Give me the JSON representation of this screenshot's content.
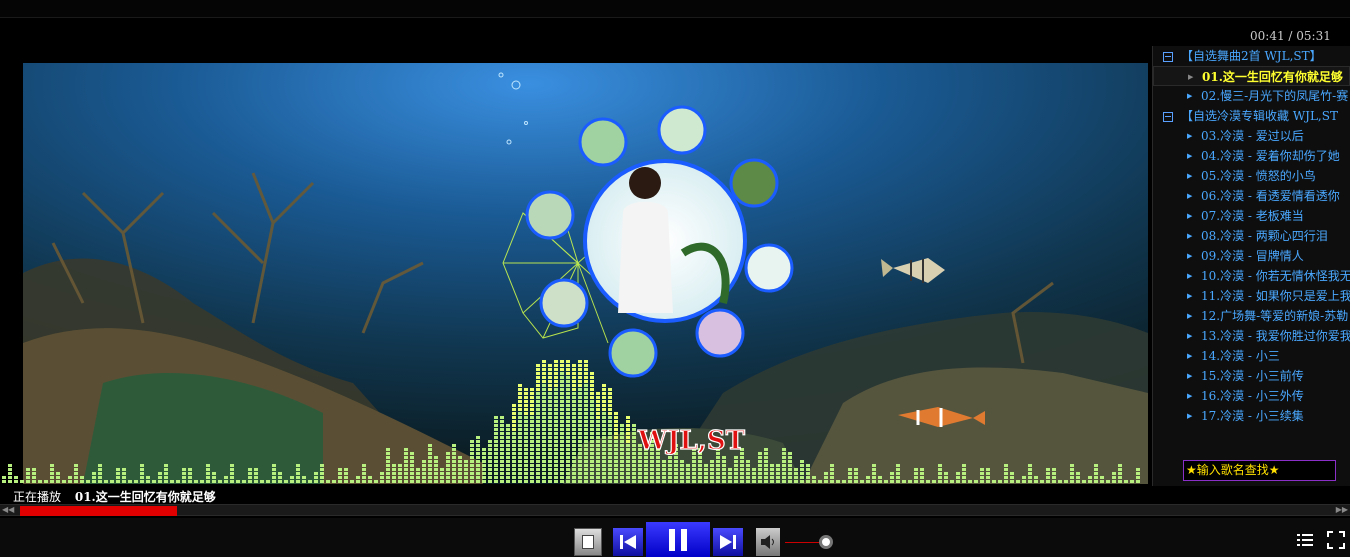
{
  "player": {
    "time_display": "00:41 / 05:31",
    "now_playing_label": "正在播放",
    "now_playing_title": "01.这一生回忆有你就足够",
    "progress_fraction": 0.12,
    "volume_fraction": 0.9,
    "watermark": "WJL,ST"
  },
  "playlist": {
    "rows": [
      {
        "kind": "group",
        "text": "【自选舞曲2首  WJL,ST】"
      },
      {
        "kind": "item",
        "text": "01.这一生回忆有你就足够",
        "active": true
      },
      {
        "kind": "item",
        "text": "02.慢三-月光下的凤尾竹-赛"
      },
      {
        "kind": "group",
        "text": "【自选冷漠专辑收藏  WJL,ST"
      },
      {
        "kind": "item",
        "text": "03.冷漠 - 爱过以后"
      },
      {
        "kind": "item",
        "text": "04.冷漠 - 爱着你却伤了她"
      },
      {
        "kind": "item",
        "text": "05.冷漠 - 愤怒的小鸟"
      },
      {
        "kind": "item",
        "text": "06.冷漠 - 看透爱情看透你"
      },
      {
        "kind": "item",
        "text": "07.冷漠 - 老板难当"
      },
      {
        "kind": "item",
        "text": "08.冷漠 - 两颗心四行泪"
      },
      {
        "kind": "item",
        "text": "09.冷漠 - 冒牌情人"
      },
      {
        "kind": "item",
        "text": "10.冷漠 - 你若无情休怪我无"
      },
      {
        "kind": "item",
        "text": "11.冷漠 - 如果你只是爱上我"
      },
      {
        "kind": "item",
        "text": "12.广场舞-等爱的新娘-苏勒"
      },
      {
        "kind": "item",
        "text": "13.冷漠 - 我爱你胜过你爱我"
      },
      {
        "kind": "item",
        "text": "14.冷漠 - 小三"
      },
      {
        "kind": "item",
        "text": "15.冷漠 - 小三前传"
      },
      {
        "kind": "item",
        "text": "16.冷漠 - 小三外传"
      },
      {
        "kind": "item",
        "text": "17.冷漠 - 小三续集"
      }
    ],
    "search_placeholder": "★输入歌名查找★"
  },
  "icons": {
    "stop": "stop-icon",
    "prev": "previous-track-icon",
    "play_pause": "pause-icon",
    "next": "next-track-icon",
    "volume": "speaker-icon",
    "playlist": "list-icon",
    "fullscreen": "fullscreen-icon"
  },
  "colors": {
    "accent": "#0000c8",
    "progress": "#e00000",
    "list_text": "#4aa8ff",
    "active_text": "#ffff30",
    "search_border": "#8a30c8",
    "eq_bar": "#b8f080"
  }
}
